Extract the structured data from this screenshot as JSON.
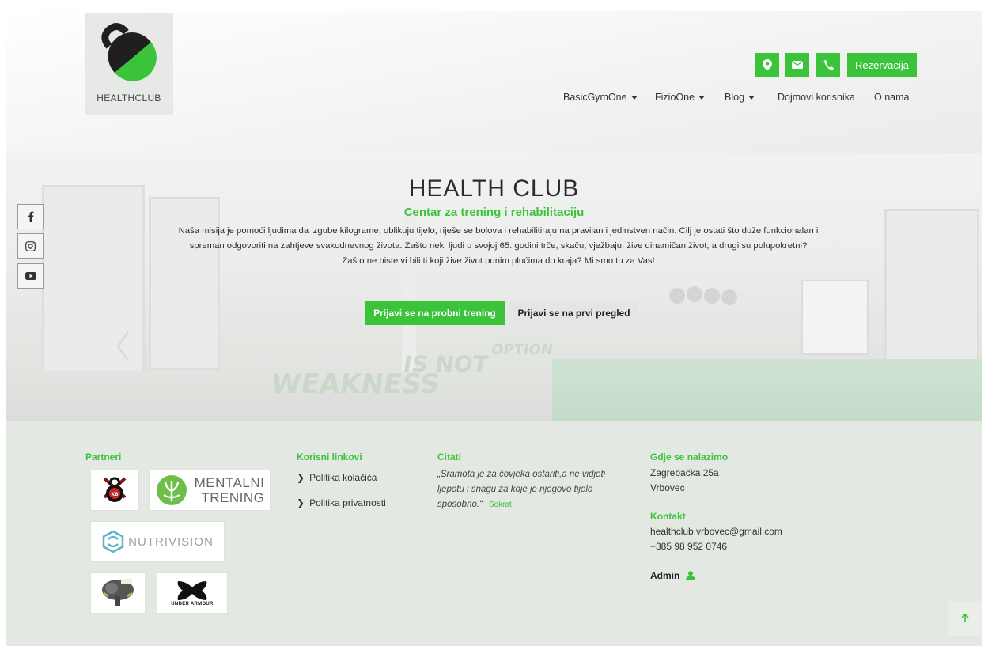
{
  "logo": {
    "text": "HEALTHCLUB"
  },
  "header": {
    "reservation_label": "Rezervacija",
    "contact_icons": [
      "map-marker-icon",
      "envelope-icon",
      "phone-icon"
    ],
    "nav": [
      {
        "label": "BasicGymOne",
        "dropdown": true
      },
      {
        "label": "FizioOne",
        "dropdown": true
      },
      {
        "label": "Blog",
        "dropdown": true
      },
      {
        "label": "Dojmovi korisnika",
        "dropdown": false
      },
      {
        "label": "O nama",
        "dropdown": false
      }
    ]
  },
  "hero": {
    "title": "HEALTH CLUB",
    "subtitle": "Centar za trening i rehabilitaciju",
    "description": "Naša misija je pomoći ljudima da izgube kilograme, oblikuju tijelo, riješe se bolova i rehabilitiraju na pravilan i jedinstven način. Cilj je ostati što duže funkcionalan i spreman odgovoriti na zahtjeve svakodnevnog života. Zašto neki ljudi u svojoj 65. godini trče, skaču, vježbaju, žive dinamičan život, a drugi su polupokretni? Zašto ne biste vi bili ti koji žive život punim plućima do kraja? Mi smo tu za Vas!",
    "cta_primary": "Prijavi se na probni trening",
    "cta_secondary": "Prijavi se na prvi pregled",
    "wall_text_1": "WEAKNESS",
    "wall_text_2": "IS NOT",
    "wall_text_3": "OPTION"
  },
  "social": [
    "facebook-icon",
    "instagram-icon",
    "youtube-icon"
  ],
  "footer": {
    "partners_heading": "Partneri",
    "partners": [
      {
        "name": "kettlebell-partner-logo"
      },
      {
        "name": "MENTALNI",
        "line2": "TRENING"
      },
      {
        "name": "NUTRIVISION"
      },
      {
        "name": "tree-partner-logo"
      },
      {
        "name": "UNDER ARMOUR"
      }
    ],
    "links_heading": "Korisni linkovi",
    "links": [
      "Politika kolačića",
      "Politika privatnosti"
    ],
    "quotes_heading": "Citati",
    "quote": "„Sramota je za čovjeka ostariti,a ne vidjeti ljepotu i snagu za koje je njegovo tijelo sposobno.“",
    "quote_author": "Sokrat",
    "location_heading": "Gdje se nalazimo",
    "address_line1": "Zagrebačka 25a",
    "address_line2": "Vrbovec",
    "contact_heading": "Kontakt",
    "email": "healthclub.vrbovec@gmail.com",
    "phone": "+385 98 952 0746",
    "admin_label": "Admin"
  },
  "colors": {
    "accent": "#3bc33b",
    "footer_bg": "#e3e9e2",
    "logo_dark": "#1f1f1f"
  }
}
